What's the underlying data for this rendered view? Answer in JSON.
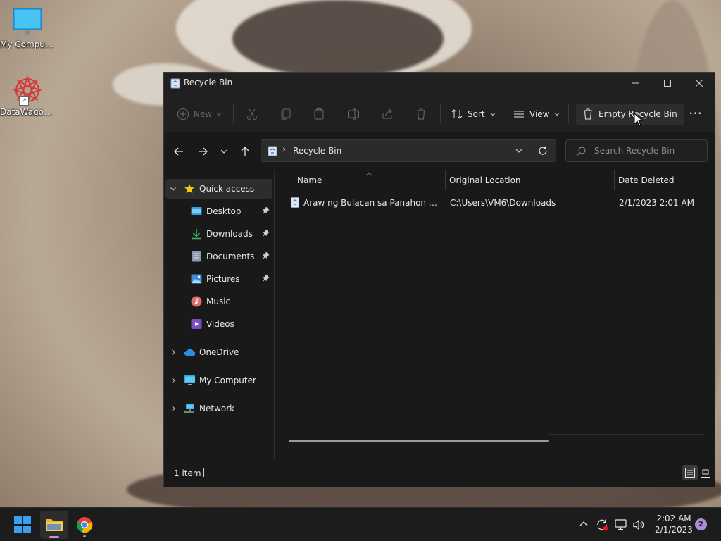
{
  "desktop": {
    "icons": [
      {
        "label": "My Computer"
      },
      {
        "label": "DataWagon..."
      }
    ]
  },
  "window": {
    "title": "Recycle Bin",
    "toolbar": {
      "new_label": "New",
      "sort_label": "Sort",
      "view_label": "View",
      "empty_label": "Empty Recycle Bin",
      "more_label": "•••"
    },
    "address": {
      "path": "Recycle Bin",
      "separator": "›"
    },
    "search": {
      "placeholder": "Search Recycle Bin"
    },
    "nav": {
      "quick_access": "Quick access",
      "pinned": [
        {
          "label": "Desktop"
        },
        {
          "label": "Downloads"
        },
        {
          "label": "Documents"
        },
        {
          "label": "Pictures"
        }
      ],
      "other": [
        {
          "label": "Music"
        },
        {
          "label": "Videos"
        }
      ],
      "onedrive": "OneDrive",
      "my_computer": "My Computer",
      "network": "Network"
    },
    "columns": {
      "name": "Name",
      "original_location": "Original Location",
      "date_deleted": "Date Deleted"
    },
    "files": [
      {
        "name": "Araw ng Bulacan sa Panahon ng P...",
        "original_location": "C:\\Users\\VM6\\Downloads",
        "date_deleted": "2/1/2023 2:01 AM"
      }
    ],
    "status": {
      "item_count": "1 item"
    }
  },
  "taskbar": {
    "time": "2:02 AM",
    "date": "2/1/2023",
    "notification_count": "2"
  },
  "colors": {
    "accent": "#0067c0",
    "window_bg": "#191919",
    "toolbar_bg": "#202020",
    "notification_badge": "#b08cd8"
  }
}
